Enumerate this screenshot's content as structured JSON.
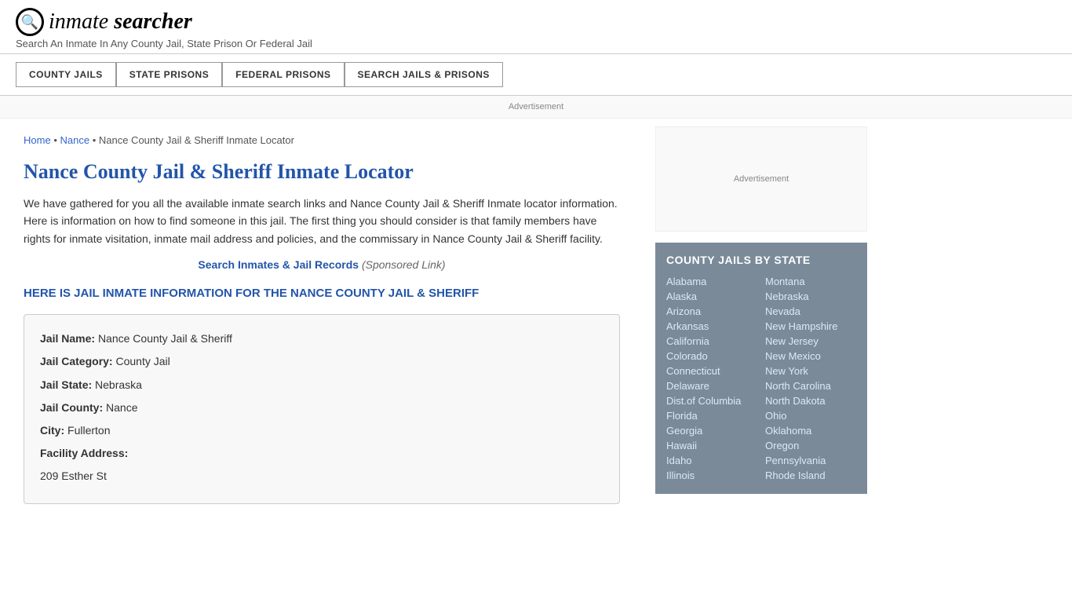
{
  "header": {
    "logo_icon": "🔍",
    "logo_text_1": "inmate",
    "logo_text_2": "searcher",
    "tagline": "Search An Inmate In Any County Jail, State Prison Or Federal Jail"
  },
  "nav": {
    "buttons": [
      {
        "label": "COUNTY JAILS",
        "name": "county-jails-btn"
      },
      {
        "label": "STATE PRISONS",
        "name": "state-prisons-btn"
      },
      {
        "label": "FEDERAL PRISONS",
        "name": "federal-prisons-btn"
      },
      {
        "label": "SEARCH JAILS & PRISONS",
        "name": "search-jails-btn"
      }
    ]
  },
  "ad_label": "Advertisement",
  "breadcrumb": {
    "home": "Home",
    "nance": "Nance",
    "current": "Nance County Jail & Sheriff Inmate Locator"
  },
  "page_title": "Nance County Jail & Sheriff Inmate Locator",
  "description": "We have gathered for you all the available inmate search links and Nance County Jail & Sheriff Inmate locator information. Here is information on how to find someone in this jail. The first thing you should consider is that family members have rights for inmate visitation, inmate mail address and policies, and the commissary in Nance County Jail & Sheriff facility.",
  "sponsored": {
    "link_text": "Search Inmates & Jail Records",
    "note": "(Sponsored Link)"
  },
  "jail_info_heading": "HERE IS JAIL INMATE INFORMATION FOR THE NANCE COUNTY JAIL & SHERIFF",
  "jail_details": {
    "name_label": "Jail Name:",
    "name_value": "Nance County Jail & Sheriff",
    "category_label": "Jail Category:",
    "category_value": "County Jail",
    "state_label": "Jail State:",
    "state_value": "Nebraska",
    "county_label": "Jail County:",
    "county_value": "Nance",
    "city_label": "City:",
    "city_value": "Fullerton",
    "address_label": "Facility Address:",
    "address_value": "209 Esther St"
  },
  "sidebar": {
    "ad_label": "Advertisement",
    "state_box_title": "COUNTY JAILS BY STATE",
    "states_col1": [
      "Alabama",
      "Alaska",
      "Arizona",
      "Arkansas",
      "California",
      "Colorado",
      "Connecticut",
      "Delaware",
      "Dist.of Columbia",
      "Florida",
      "Georgia",
      "Hawaii",
      "Idaho",
      "Illinois"
    ],
    "states_col2": [
      "Montana",
      "Nebraska",
      "Nevada",
      "New Hampshire",
      "New Jersey",
      "New Mexico",
      "New York",
      "North Carolina",
      "North Dakota",
      "Ohio",
      "Oklahoma",
      "Oregon",
      "Pennsylvania",
      "Rhode Island"
    ]
  }
}
